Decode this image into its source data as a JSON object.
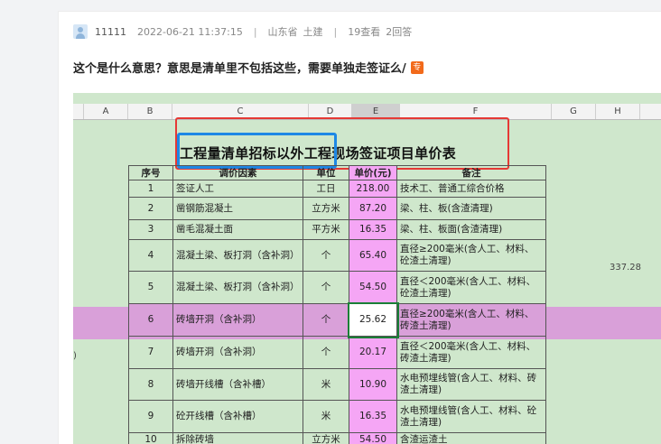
{
  "post": {
    "username": "11111",
    "datetime": "2022-06-21 11:37:15",
    "location": "山东省",
    "category": "土建",
    "views": "19查看",
    "answers": "2回答",
    "question": "这个是什么意思？意思是清单里不包括这些，需要单独走签证么/",
    "badge": "专"
  },
  "sheet": {
    "columns": [
      "A",
      "B",
      "C",
      "D",
      "E",
      "F",
      "G",
      "H"
    ],
    "title": "工程量清单招标以外工程现场签证项目单价表",
    "headers": [
      "序号",
      "调价因素",
      "单位",
      "单价(元)",
      "备注"
    ],
    "rows": [
      {
        "no": "1",
        "item": "签证人工",
        "unit": "工日",
        "price": "218.00",
        "note": "技术工、普通工综合价格"
      },
      {
        "no": "2",
        "item": "凿钢筋混凝土",
        "unit": "立方米",
        "price": "87.20",
        "note": "梁、柱、板(含渣清理)"
      },
      {
        "no": "3",
        "item": "凿毛混凝土面",
        "unit": "平方米",
        "price": "16.35",
        "note": "梁、柱、板面(含渣清理)"
      },
      {
        "no": "4",
        "item": "混凝土梁、板打洞（含补洞）",
        "unit": "个",
        "price": "65.40",
        "note": "直径≥200毫米(含人工、材料、砼渣土清理)"
      },
      {
        "no": "5",
        "item": "混凝土梁、板打洞（含补洞）",
        "unit": "个",
        "price": "54.50",
        "note": "直径＜200毫米(含人工、材料、砼渣土清理)"
      },
      {
        "no": "6",
        "item": "砖墙开洞（含补洞）",
        "unit": "个",
        "price": "25.62",
        "note": "直径≥200毫米(含人工、材料、砖渣土清理)"
      },
      {
        "no": "7",
        "item": "砖墙开洞（含补洞）",
        "unit": "个",
        "price": "20.17",
        "note": "直径＜200毫米(含人工、材料、砖渣土清理)"
      },
      {
        "no": "8",
        "item": "砖墙开线槽（含补槽）",
        "unit": "米",
        "price": "10.90",
        "note": "水电预埋线管(含人工、材料、砖渣土清理)"
      },
      {
        "no": "9",
        "item": "砼开线槽（含补槽）",
        "unit": "米",
        "price": "16.35",
        "note": "水电预埋线管(含人工、材料、砼渣土清理)"
      },
      {
        "no": "10",
        "item": "拆除砖墙",
        "unit": "立方米",
        "price": "54.50",
        "note": "含渣运渣土"
      }
    ],
    "side_value": "337.28",
    "row_stub": ")"
  }
}
